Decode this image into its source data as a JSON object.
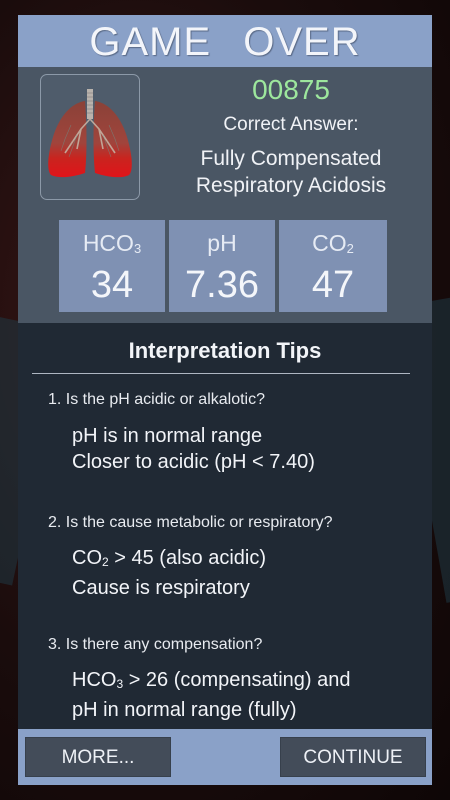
{
  "header": {
    "title": "GAME   OVER"
  },
  "result": {
    "score": "00875",
    "correct_label": "Correct Answer:",
    "answer_line1": "Fully Compensated",
    "answer_line2": "Respiratory Acidosis"
  },
  "stats": [
    {
      "label": "HCO",
      "sub": "3",
      "value": "34"
    },
    {
      "label": "pH",
      "sub": "",
      "value": "7.36"
    },
    {
      "label": "CO",
      "sub": "2",
      "value": "47"
    }
  ],
  "tips": {
    "title": "Interpretation Tips",
    "items": [
      {
        "question": "1. Is the pH acidic or alkalotic?",
        "line1": "pH is in normal range",
        "line2": "Closer to acidic (pH < 7.40)"
      },
      {
        "question": "2. Is the cause metabolic or respiratory?",
        "line1_prefix": "CO",
        "line1_sub": "2",
        "line1_suffix": " > 45 (also acidic)",
        "line2": "Cause is respiratory"
      },
      {
        "question": "3. Is there any compensation?",
        "line1_prefix": "HCO",
        "line1_sub": "3",
        "line1_suffix": " > 26 (compensating) and",
        "line2": "pH in normal range (fully)"
      }
    ]
  },
  "footer": {
    "more_label": "MORE...",
    "continue_label": "CONTINUE"
  },
  "colors": {
    "header_bg": "#8aa1c8",
    "panel_bg": "#4a5664",
    "tips_bg": "#202934",
    "score_color": "#9de79d",
    "stat_box_bg": "#7f91b3",
    "lung_red": "#e0141a"
  },
  "icons": {
    "lungs": "lungs-icon"
  }
}
